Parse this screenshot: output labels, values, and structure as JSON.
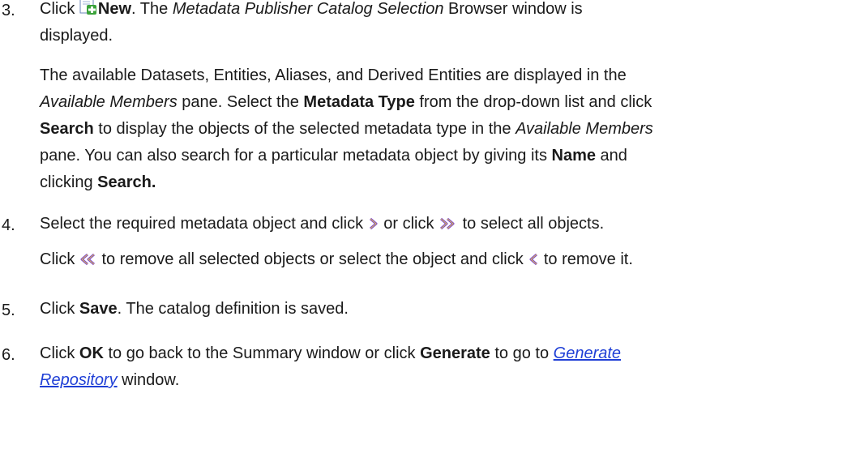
{
  "step3": {
    "number": "3.",
    "click": "Click",
    "new": "New",
    "after_new": ". The",
    "window_name": "Metadata Publisher Catalog Selection",
    "after_window": "Browser window is",
    "line2": "displayed.",
    "para2": {
      "l1": "The available Datasets, Entities, Aliases, and Derived Entities are displayed in the",
      "l2_pane": "Available Members",
      "l2_mid": "pane. Select the",
      "l2_bold": "Metadata Type",
      "l2_end": "from the drop-down list and click",
      "l3_search": "Search",
      "l3_mid": "to display the objects of the selected metadata type in the",
      "l3_pane": "Available Members",
      "l4_a": "pane. You can also search for a particular metadata object by giving its",
      "l4_name": "Name",
      "l4_and": "and",
      "l5_a": "clicking",
      "l5_search": "Search."
    }
  },
  "step4": {
    "number": "4.",
    "l1_a": "Select the required metadata object and click",
    "l1_b": "or click",
    "l1_c": "to select all objects.",
    "l2_a": "Click",
    "l2_b": "to remove all selected objects or select the object and click",
    "l2_c": "to remove it."
  },
  "step5": {
    "number": "5.",
    "click": "Click",
    "save": "Save",
    "rest": ". The catalog definition is saved."
  },
  "step6": {
    "number": "6.",
    "click": "Click",
    "ok": "OK",
    "mid": "to go back to the Summary window or click",
    "generate": "Generate",
    "to_go": "to go to",
    "link_l1": "Generate",
    "link_l2": "Repository",
    "end": "window."
  },
  "icons": {
    "new": "new-document-add-icon",
    "move_right": "chevron-right-icon",
    "move_all_right": "double-chevron-right-icon",
    "move_all_left": "double-chevron-left-icon",
    "move_left": "chevron-left-icon",
    "icon_color": "#7b3fd0",
    "link_color": "#1f3fd6"
  }
}
